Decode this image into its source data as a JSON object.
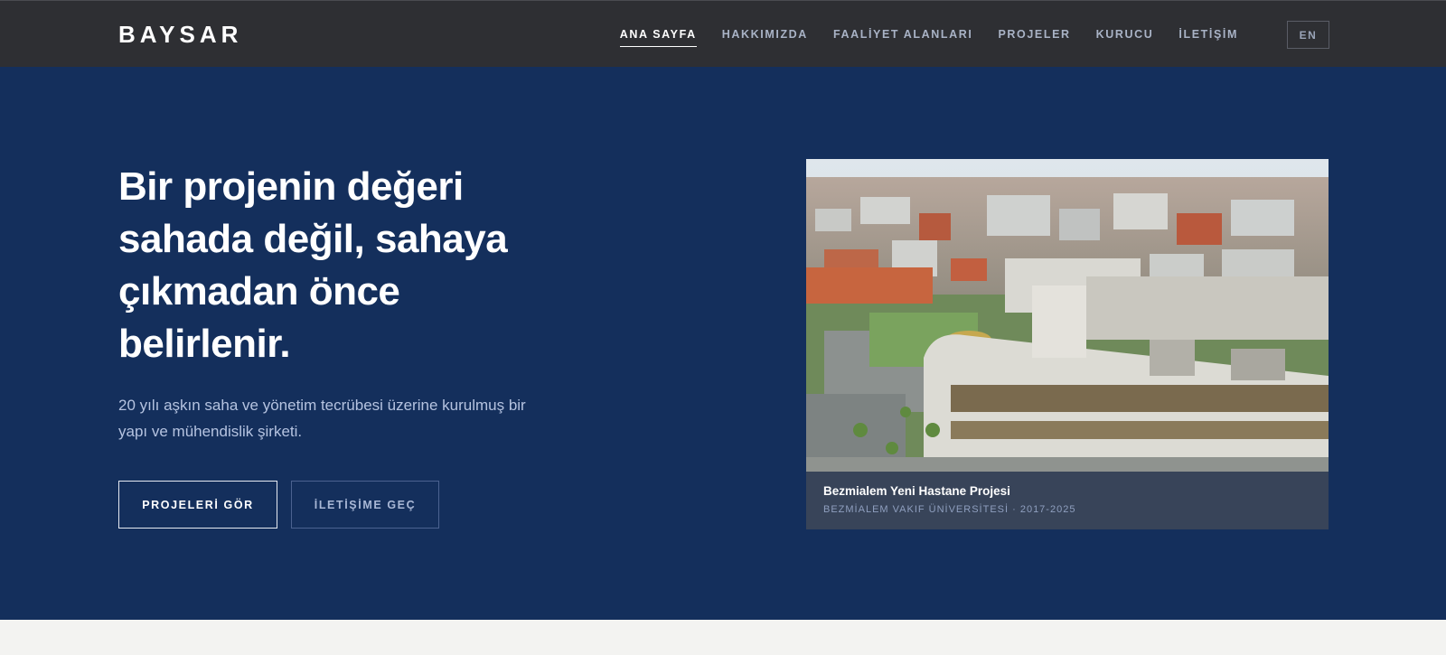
{
  "header": {
    "logo": "BAYSAR",
    "nav": [
      {
        "label": "ANA SAYFA",
        "active": true
      },
      {
        "label": "HAKKIMIZDA",
        "active": false
      },
      {
        "label": "FAALİYET ALANLARI",
        "active": false
      },
      {
        "label": "PROJELER",
        "active": false
      },
      {
        "label": "KURUCU",
        "active": false
      },
      {
        "label": "İLETİŞİM",
        "active": false
      }
    ],
    "lang": "EN"
  },
  "hero": {
    "headline_lines": [
      "Bir projenin değeri",
      "sahada değil, sahaya",
      "çıkmadan önce",
      "belirlenir."
    ],
    "subtext_lines": [
      "20 yılı aşkın saha ve yönetim tecrübesi üzerine kurulmuş bir",
      "yapı ve mühendislik şirketi."
    ],
    "primary_button": "PROJELERİ GÖR",
    "secondary_button": "İLETİŞİME GEÇ"
  },
  "project": {
    "title": "Bezmialem Yeni Hastane Projesi",
    "meta": "BEZMİALEM VAKIF ÜNİVERSİTESİ · 2017-2025"
  },
  "colors": {
    "header_bg": "#2e2f33",
    "hero_bg": "#142f5c",
    "below_bg": "#f3f3f1"
  }
}
